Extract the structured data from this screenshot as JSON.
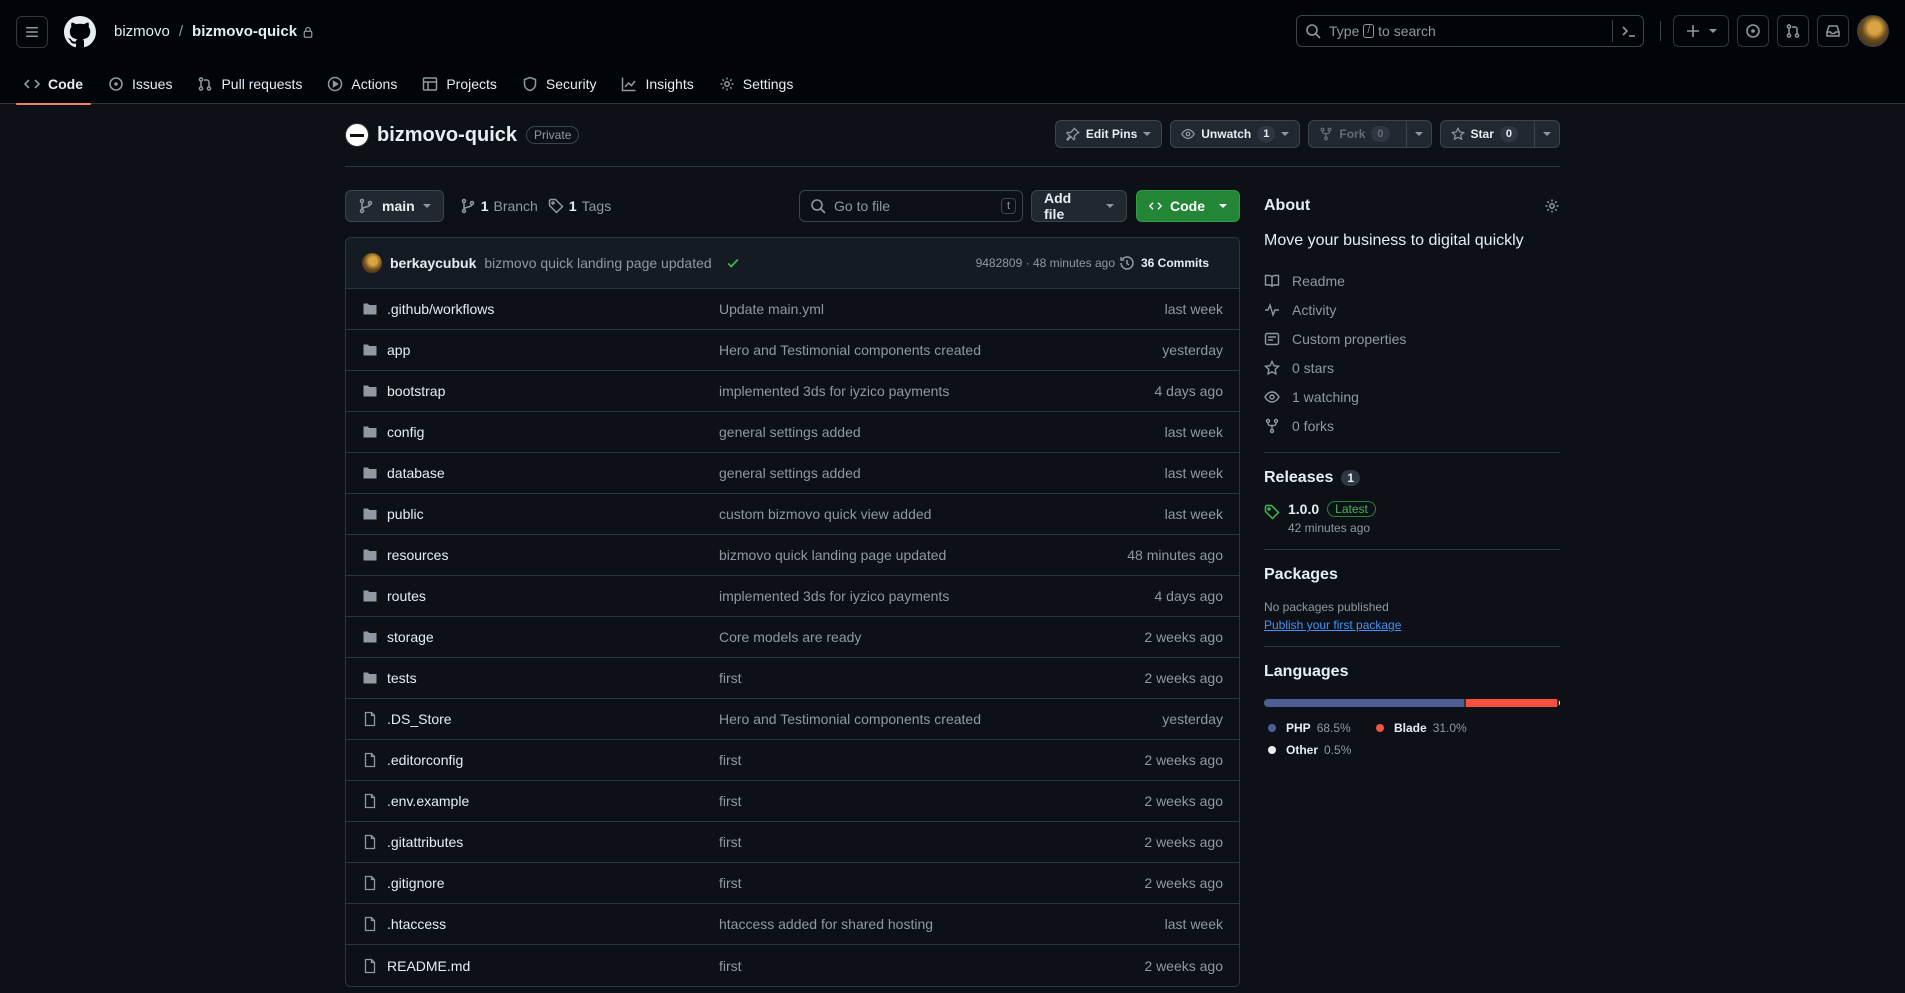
{
  "header": {
    "owner": "bizmovo",
    "separator": "/",
    "repo": "bizmovo-quick",
    "search_before": "Type",
    "search_key": "/",
    "search_after": "to search"
  },
  "nav": [
    {
      "label": "Code",
      "icon": "code-icon",
      "active": true
    },
    {
      "label": "Issues",
      "icon": "issue-icon"
    },
    {
      "label": "Pull requests",
      "icon": "pull-request-icon"
    },
    {
      "label": "Actions",
      "icon": "play-icon"
    },
    {
      "label": "Projects",
      "icon": "table-icon"
    },
    {
      "label": "Security",
      "icon": "shield-icon"
    },
    {
      "label": "Insights",
      "icon": "graph-icon"
    },
    {
      "label": "Settings",
      "icon": "gear-icon"
    }
  ],
  "repo_header": {
    "title": "bizmovo-quick",
    "visibility": "Private",
    "edit_pins": "Edit Pins",
    "unwatch": "Unwatch",
    "unwatch_count": "1",
    "fork": "Fork",
    "fork_count": "0",
    "star": "Star",
    "star_count": "0"
  },
  "toolbar": {
    "branch": "main",
    "branch_count": "1",
    "branch_label": "Branch",
    "tags_count": "1",
    "tags_label": "Tags",
    "goto_placeholder": "Go to file",
    "goto_key": "t",
    "add_file": "Add file",
    "code": "Code"
  },
  "latest_commit": {
    "author": "berkaycubuk",
    "message": "bizmovo quick landing page updated",
    "meta": "9482809 · 48 minutes ago",
    "commits": "36 Commits"
  },
  "files": [
    {
      "type": "dir",
      "name": ".github/workflows",
      "message": "Update main.yml",
      "date": "last week"
    },
    {
      "type": "dir",
      "name": "app",
      "message": "Hero and Testimonial components created",
      "date": "yesterday"
    },
    {
      "type": "dir",
      "name": "bootstrap",
      "message": "implemented 3ds for iyzico payments",
      "date": "4 days ago"
    },
    {
      "type": "dir",
      "name": "config",
      "message": "general settings added",
      "date": "last week"
    },
    {
      "type": "dir",
      "name": "database",
      "message": "general settings added",
      "date": "last week"
    },
    {
      "type": "dir",
      "name": "public",
      "message": "custom bizmovo quick view added",
      "date": "last week"
    },
    {
      "type": "dir",
      "name": "resources",
      "message": "bizmovo quick landing page updated",
      "date": "48 minutes ago"
    },
    {
      "type": "dir",
      "name": "routes",
      "message": "implemented 3ds for iyzico payments",
      "date": "4 days ago"
    },
    {
      "type": "dir",
      "name": "storage",
      "message": "Core models are ready",
      "date": "2 weeks ago"
    },
    {
      "type": "dir",
      "name": "tests",
      "message": "first",
      "date": "2 weeks ago"
    },
    {
      "type": "file",
      "name": ".DS_Store",
      "message": "Hero and Testimonial components created",
      "date": "yesterday"
    },
    {
      "type": "file",
      "name": ".editorconfig",
      "message": "first",
      "date": "2 weeks ago"
    },
    {
      "type": "file",
      "name": ".env.example",
      "message": "first",
      "date": "2 weeks ago"
    },
    {
      "type": "file",
      "name": ".gitattributes",
      "message": "first",
      "date": "2 weeks ago"
    },
    {
      "type": "file",
      "name": ".gitignore",
      "message": "first",
      "date": "2 weeks ago"
    },
    {
      "type": "file",
      "name": ".htaccess",
      "message": "htaccess added for shared hosting",
      "date": "last week"
    },
    {
      "type": "file",
      "name": "README.md",
      "message": "first",
      "date": "2 weeks ago"
    }
  ],
  "about": {
    "heading": "About",
    "description": "Move your business to digital quickly",
    "items": [
      {
        "icon": "book-icon",
        "label": "Readme"
      },
      {
        "icon": "pulse-icon",
        "label": "Activity"
      },
      {
        "icon": "note-icon",
        "label": "Custom properties"
      },
      {
        "icon": "star-icon",
        "label": "0 stars"
      },
      {
        "icon": "eye-icon",
        "label": "1 watching"
      },
      {
        "icon": "fork-icon",
        "label": "0 forks"
      }
    ]
  },
  "releases": {
    "heading": "Releases",
    "count": "1",
    "name": "1.0.0",
    "badge": "Latest",
    "time": "42 minutes ago"
  },
  "packages": {
    "heading": "Packages",
    "none": "No packages published",
    "link": "Publish your first package"
  },
  "languages": {
    "heading": "Languages",
    "items": [
      {
        "name": "PHP",
        "pct": "68.5%",
        "value": 68.5,
        "color": "#4F5D95"
      },
      {
        "name": "Blade",
        "pct": "31.0%",
        "value": 31.0,
        "color": "#f7523f"
      },
      {
        "name": "Other",
        "pct": "0.5%",
        "value": 0.5,
        "color": "#ededed"
      }
    ]
  }
}
